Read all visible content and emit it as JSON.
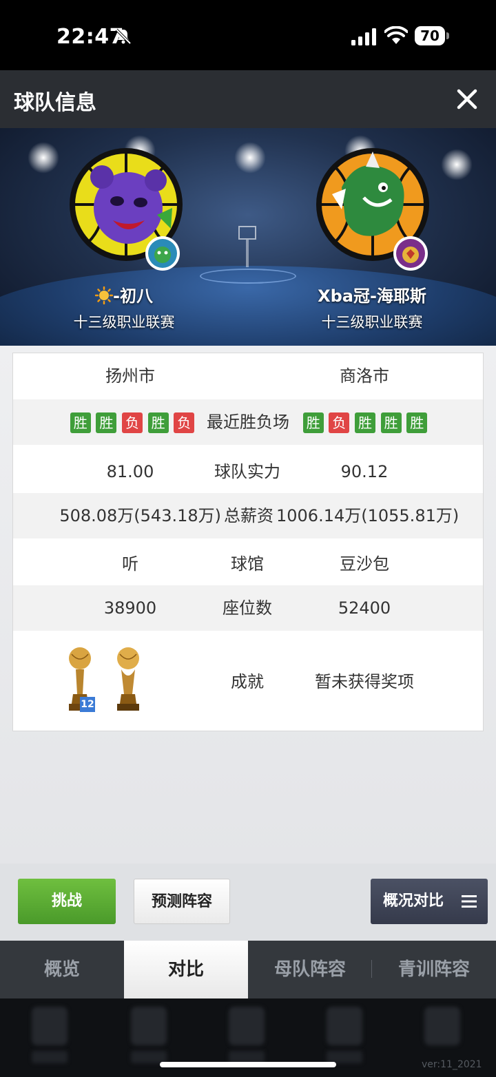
{
  "status_bar": {
    "time": "22:47",
    "battery": "70"
  },
  "header": {
    "title": "球队信息"
  },
  "teams": {
    "home": {
      "name": "-初八",
      "league": "十三级职业联赛",
      "city": "扬州市"
    },
    "away": {
      "name": "Xba冠-海耶斯",
      "league": "十三级职业联赛",
      "city": "商洛市"
    }
  },
  "comparison": {
    "recent_label": "最近胜负场",
    "home_recent": [
      "胜",
      "胜",
      "负",
      "胜",
      "负"
    ],
    "away_recent": [
      "胜",
      "负",
      "胜",
      "胜",
      "胜"
    ],
    "strength": {
      "label": "球队实力",
      "home": "81.00",
      "away": "90.12"
    },
    "salary": {
      "label": "总薪资",
      "home": "508.08万(543.18万)",
      "away": "1006.14万(1055.81万)"
    },
    "arena": {
      "label": "球馆",
      "home": "听",
      "away": "豆沙包"
    },
    "seats": {
      "label": "座位数",
      "home": "38900",
      "away": "52400"
    },
    "achievements": {
      "label": "成就",
      "home_trophy_count": "12",
      "away": "暂未获得奖项"
    }
  },
  "actions": {
    "challenge": "挑战",
    "predict": "预测阵容",
    "overview": "概况对比"
  },
  "tabs": [
    "概览",
    "对比",
    "母队阵容",
    "青训阵容"
  ],
  "active_tab": 1,
  "version": "ver:11_2021",
  "colors": {
    "win": "#3f9e3a",
    "loss": "#e04545",
    "challenge": "#5aab33",
    "header": "#2b2e33"
  }
}
